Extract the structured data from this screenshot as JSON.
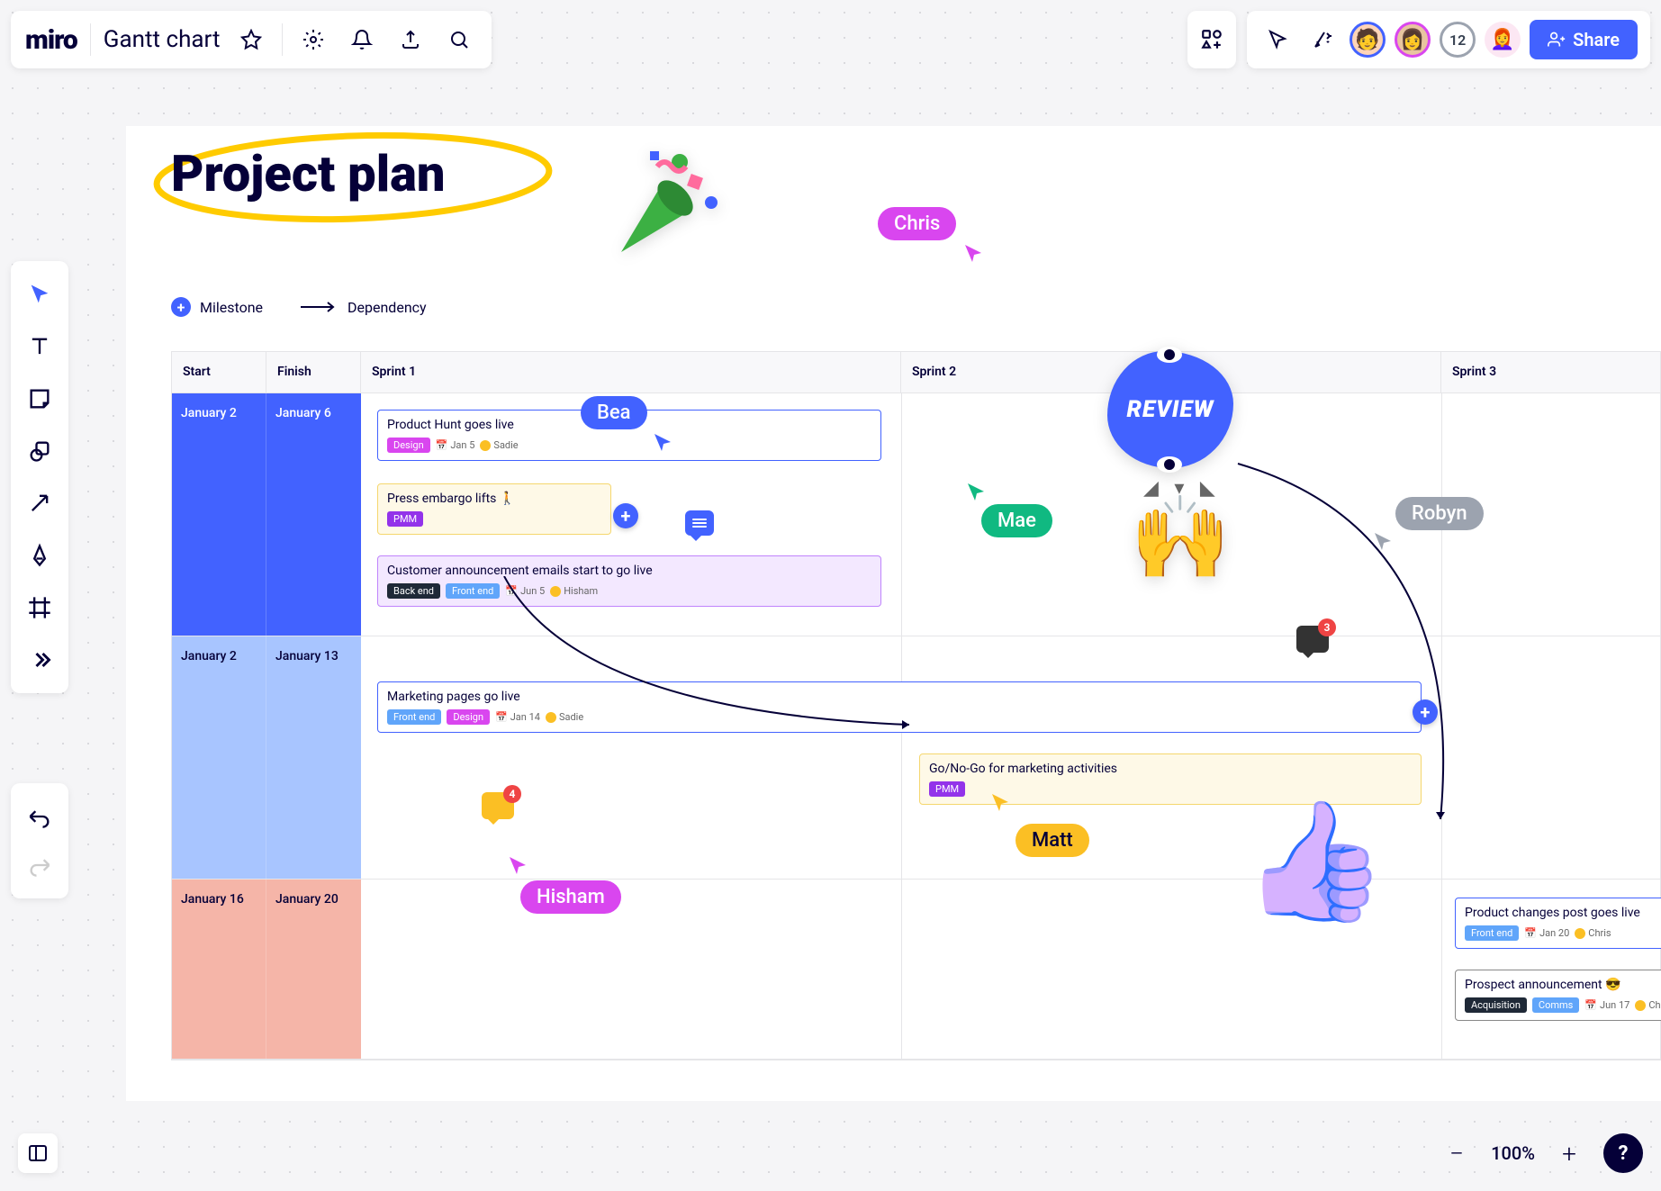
{
  "app": {
    "logo": "miro",
    "board_title": "Gantt chart"
  },
  "collab": {
    "overflow_count": "12",
    "share_label": "Share"
  },
  "board": {
    "title": "Project plan",
    "legend": {
      "milestone": "Milestone",
      "dependency": "Dependency"
    },
    "columns": {
      "start": "Start",
      "finish": "Finish",
      "sprint1": "Sprint 1",
      "sprint2": "Sprint 2",
      "sprint3": "Sprint 3"
    },
    "rows": [
      {
        "start": "January 2",
        "finish": "January 6"
      },
      {
        "start": "January 2",
        "finish": "January 13"
      },
      {
        "start": "January 16",
        "finish": "January 20"
      }
    ],
    "tasks": {
      "t1": {
        "title": "Product Hunt goes live",
        "tag1": "Design",
        "date": "Jan 5",
        "assignee": "Sadie"
      },
      "t2": {
        "title": "Press embargo lifts 🚶",
        "tag1": "PMM"
      },
      "t3": {
        "title": "Customer announcement emails start to go live",
        "tag1": "Back end",
        "tag2": "Front end",
        "date": "Jun 5",
        "assignee": "Hisham"
      },
      "t4": {
        "title": "Marketing pages go live",
        "tag1": "Front end",
        "tag2": "Design",
        "date": "Jan 14",
        "assignee": "Sadie"
      },
      "t5": {
        "title": "Go/No-Go for marketing activities",
        "tag1": "PMM"
      },
      "t6": {
        "title": "Product changes post goes live",
        "tag1": "Front end",
        "date": "Jan 20",
        "assignee": "Chris"
      },
      "t7": {
        "title": "Prospect announcement 😎",
        "tag1": "Acquisition",
        "tag2": "Comms",
        "date": "Jun 17",
        "assignee": "Chris"
      }
    },
    "cursors": {
      "chris": "Chris",
      "bea": "Bea",
      "mae": "Mae",
      "robyn": "Robyn",
      "hisham": "Hisham",
      "matt": "Matt"
    },
    "review_sticker": "REVIEW",
    "comment_counts": {
      "c1": "3",
      "c2": "4"
    }
  },
  "zoom": {
    "level": "100%"
  }
}
